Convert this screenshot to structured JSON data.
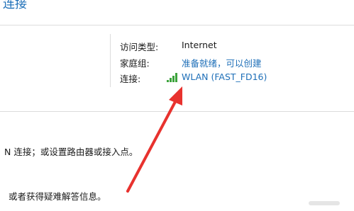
{
  "header": {
    "partial_title": "连接"
  },
  "network_info": {
    "access_type_label": "访问类型:",
    "access_type_value": "Internet",
    "homegroup_label": "家庭组:",
    "homegroup_value": "准备就绪，可以创建",
    "connection_label": "连接:",
    "connection_value": "WLAN (FAST_FD16)"
  },
  "notes": {
    "line1": "N 连接；或设置路由器或接入点。",
    "line2": "或者获得疑难解答信息。"
  },
  "colors": {
    "link": "#1e6fb8",
    "arrow": "#e8322e",
    "signal": "#3ca33c"
  }
}
